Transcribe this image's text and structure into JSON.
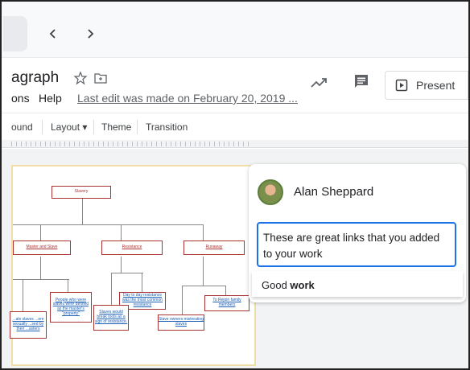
{
  "doc": {
    "title": "agraph",
    "menus": [
      "ons",
      "Help"
    ],
    "last_edit": "Last edit was made on February 20, 2019 ..."
  },
  "header": {
    "present_label": "Present"
  },
  "toolbar": {
    "items": [
      "ound",
      "Layout ▾",
      "Theme",
      "Transition"
    ]
  },
  "slide": {
    "nodes": {
      "root": "Slavery",
      "a": "Master and Slave",
      "b": "Resistance",
      "c": "Runaway",
      "a1": "People who were slaves were defined as the master's \"property\"",
      "a2": "...ale slaves ...ere sexually ...sed by their ...asters",
      "b1": "Day to day resistance was the most common resistance",
      "b2": "Slaves would break tools as a sign of resistance.",
      "c1": "To Rejoin family members",
      "c2": "Slave owners mistreating slaves"
    }
  },
  "comment": {
    "author": "Alan Sheppard",
    "reply_text": "These are great links that you added to your work",
    "suggestion_prefix": "Good ",
    "suggestion_bold": "work"
  },
  "colors": {
    "accent": "#1a73e8",
    "node_border": "#aa3333",
    "slide_border": "#f0e0a8"
  }
}
